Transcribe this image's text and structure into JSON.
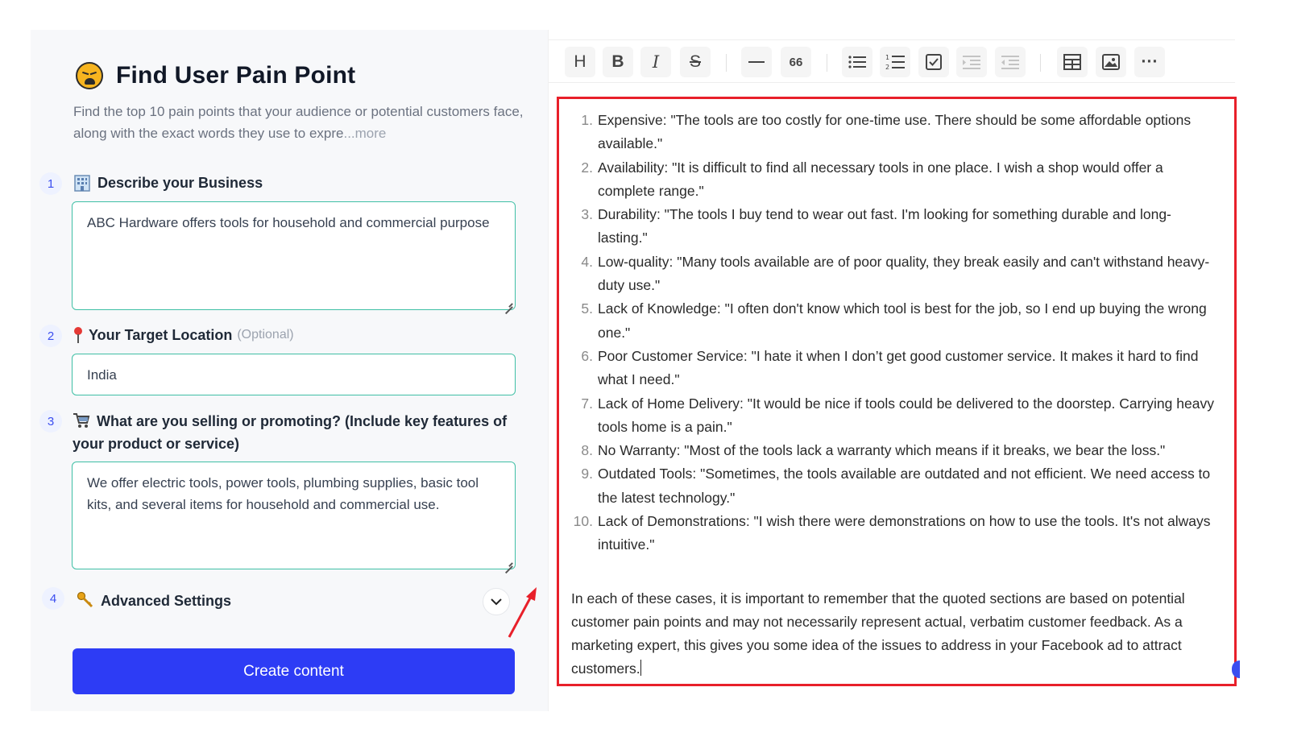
{
  "colors": {
    "accent": "#2d3cf5",
    "field_border": "#3fbfa5",
    "highlight": "#e8202a"
  },
  "left": {
    "title": "Find User Pain Point",
    "title_icon": "weary-face-emoji",
    "description": "Find the top 10 pain points that your audience or potential customers face, along with the exact words they use to expre",
    "description_more": "...more",
    "steps": [
      {
        "number": "1",
        "icon": "office-building-emoji",
        "label": "Describe your Business",
        "value": "ABC Hardware offers tools for household and commercial purpose"
      },
      {
        "number": "2",
        "icon": "round-pushpin-emoji",
        "label": "Your Target Location",
        "optional": "(Optional)",
        "value": "India"
      },
      {
        "number": "3",
        "icon": "shopping-cart-emoji",
        "label": "What are you selling or promoting? (Include key features of your product or service)",
        "value": "We offer electric tools, power tools, plumbing supplies, basic tool kits, and several items for household and commercial use."
      },
      {
        "number": "4",
        "icon": "key-emoji",
        "label": "Advanced Settings"
      }
    ],
    "create_button": "Create content"
  },
  "toolbar": {
    "buttons": [
      "heading-icon",
      "bold-icon",
      "italic-icon",
      "strikethrough-icon",
      "horizontal-rule-icon",
      "blockquote-icon",
      "bullet-list-icon",
      "ordered-list-icon",
      "task-list-icon",
      "indent-icon",
      "outdent-icon",
      "table-icon",
      "image-icon",
      "more-icon"
    ],
    "heading_label": "H",
    "bold_label": "B",
    "italic_label": "I",
    "strike_label": "S",
    "quote_label": "66",
    "more_label": "···"
  },
  "editor": {
    "items": [
      {
        "number": "1.",
        "text": "Expensive: \"The tools are too costly for one-time use. There should be some affordable options available.\""
      },
      {
        "number": "2.",
        "text": "Availability: \"It is difficult to find all necessary tools in one place. I wish a shop would offer a complete range.\""
      },
      {
        "number": "3.",
        "text": "Durability: \"The tools I buy tend to wear out fast. I'm looking for something durable and long-lasting.\""
      },
      {
        "number": "4.",
        "text": "Low-quality: \"Many tools available are of poor quality, they break easily and can't withstand heavy-duty use.\""
      },
      {
        "number": "5.",
        "text": "Lack of Knowledge: \"I often don't know which tool is best for the job, so I end up buying the wrong one.\""
      },
      {
        "number": "6.",
        "text": "Poor Customer Service: \"I hate it when I don’t get good customer service. It makes it hard to find what I need.\""
      },
      {
        "number": "7.",
        "text": "Lack of Home Delivery: \"It would be nice if tools could be delivered to the doorstep. Carrying heavy tools home is a pain.\""
      },
      {
        "number": "8.",
        "text": "No Warranty: \"Most of the tools lack a warranty which means if it breaks, we bear the loss.\""
      },
      {
        "number": "9.",
        "text": "Outdated Tools: \"Sometimes, the tools available are outdated and not efficient. We need access to the latest technology.\""
      },
      {
        "number": "10.",
        "text": "Lack of Demonstrations: \"I wish there were demonstrations on how to use the tools. It's not always intuitive.\""
      }
    ],
    "summary": "In each of these cases, it is important to remember that the quoted sections are based on potential customer pain points and may not necessarily represent actual, verbatim customer feedback. As a marketing expert, this gives you some idea of the issues to address in your Facebook ad to attract customers."
  }
}
